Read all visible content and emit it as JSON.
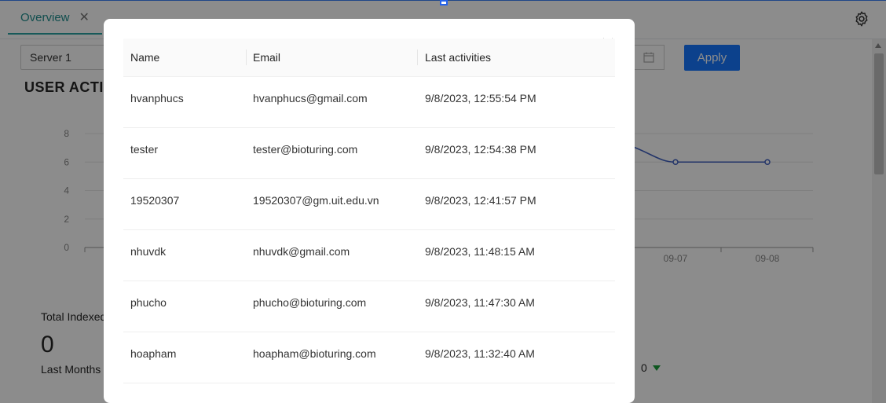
{
  "tab": {
    "label": "Overview",
    "close": "✕"
  },
  "server_select": {
    "value": "Server 1"
  },
  "apply_button": "Apply",
  "section_title": "USER ACTIVITIES",
  "chart_data": {
    "type": "line",
    "x": [
      "09-07",
      "09-08"
    ],
    "y_ticks": [
      "0",
      "2",
      "4",
      "6",
      "8"
    ],
    "ylim": [
      0,
      8
    ],
    "series": [
      {
        "values": [
          6,
          6
        ]
      }
    ],
    "x_tick_labels": [
      "09-07",
      "09-08"
    ],
    "grid": true,
    "line_color": "#3f5fbf"
  },
  "stats": {
    "total_label": "Total Indexed",
    "total_value": "0",
    "sub_label": "Last Months",
    "right_value": "0"
  },
  "modal": {
    "columns": [
      "Name",
      "Email",
      "Last activities"
    ],
    "rows": [
      {
        "name": "hvanphucs",
        "email": "hvanphucs@gmail.com",
        "time": "9/8/2023, 12:55:54 PM"
      },
      {
        "name": "tester",
        "email": "tester@bioturing.com",
        "time": "9/8/2023, 12:54:38 PM"
      },
      {
        "name": "19520307",
        "email": "19520307@gm.uit.edu.vn",
        "time": "9/8/2023, 12:41:57 PM"
      },
      {
        "name": "nhuvdk",
        "email": "nhuvdk@gmail.com",
        "time": "9/8/2023, 11:48:15 AM"
      },
      {
        "name": "phucho",
        "email": "phucho@bioturing.com",
        "time": "9/8/2023, 11:47:30 AM"
      },
      {
        "name": "hoapham",
        "email": "hoapham@bioturing.com",
        "time": "9/8/2023, 11:32:40 AM"
      }
    ]
  },
  "colors": {
    "accent": "#1677ff",
    "tab_accent": "#1f8f8f",
    "trend_down": "#1a9d3a"
  },
  "icons": {
    "gear": "gear-icon",
    "calendar": "calendar-icon",
    "close": "close-icon"
  }
}
